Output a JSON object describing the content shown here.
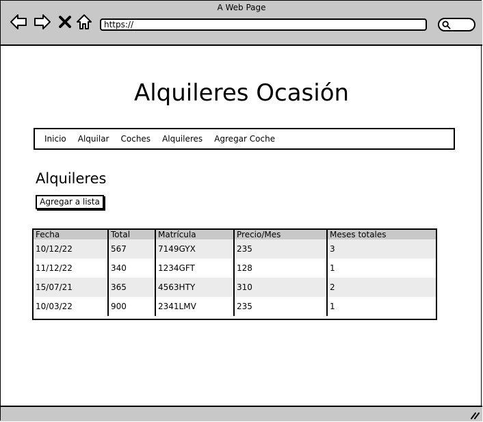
{
  "window": {
    "title": "A Web Page"
  },
  "toolbar": {
    "url": "https://",
    "icons": [
      "back-arrow-icon",
      "forward-arrow-icon",
      "close-x-icon",
      "home-icon",
      "search-icon"
    ]
  },
  "page": {
    "heading": "Alquileres Ocasión",
    "menu": [
      "Inicio",
      "Alquilar",
      "Coches",
      "Alquileres",
      "Agregar Coche"
    ],
    "section_title": "Alquileres",
    "add_button_label": "Agregar a lista"
  },
  "table": {
    "headers": [
      "Fecha",
      "Total",
      "Matrícula",
      "Precio/Mes",
      "Meses totales"
    ],
    "rows": [
      [
        "10/12/22",
        "567",
        "7149GYX",
        "235",
        "3"
      ],
      [
        "11/12/22",
        "340",
        "1234GFT",
        "128",
        "1"
      ],
      [
        "15/07/21",
        "365",
        "4563HTY",
        "310",
        "2"
      ],
      [
        "10/03/22",
        "900",
        "2341LMV",
        "235",
        "1"
      ]
    ]
  },
  "colors": {
    "chrome": "#c8c8c8",
    "row_alt": "#ebebeb",
    "border": "#000000"
  }
}
